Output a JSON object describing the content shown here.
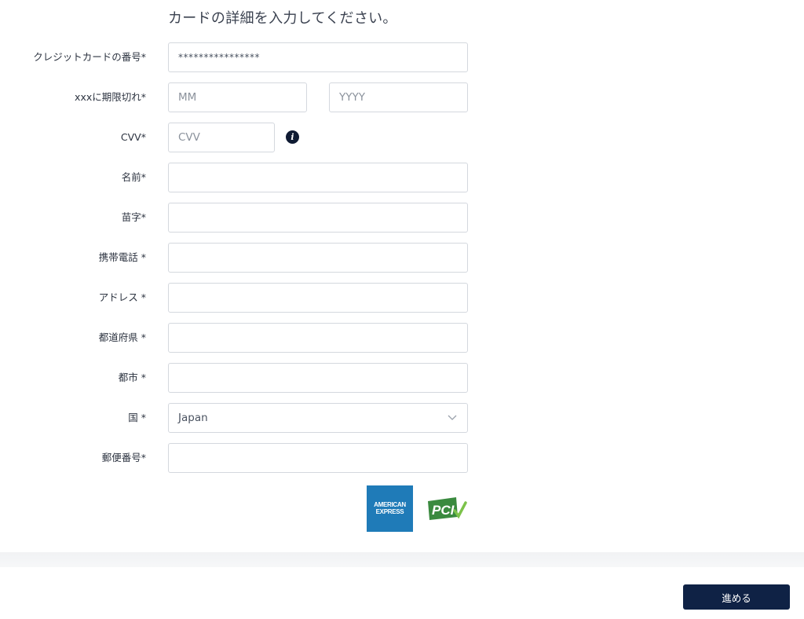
{
  "heading": "カードの詳細を入力してください。",
  "fields": {
    "card_number": {
      "label": "クレジットカードの番号*",
      "value": "****************"
    },
    "expiry": {
      "label": "xxxに期限切れ*",
      "month_placeholder": "MM",
      "year_placeholder": "YYYY"
    },
    "cvv": {
      "label": "CVV*",
      "placeholder": "CVV",
      "info_icon": "info-icon"
    },
    "first_name": {
      "label": "名前*",
      "value": ""
    },
    "last_name": {
      "label": "苗字*",
      "value": ""
    },
    "mobile": {
      "label": "携帯電話 *",
      "value": ""
    },
    "address": {
      "label": "アドレス *",
      "value": ""
    },
    "prefecture": {
      "label": "都道府県 *",
      "value": ""
    },
    "city": {
      "label": "都市 *",
      "value": ""
    },
    "country": {
      "label": "国 *",
      "value": "Japan"
    },
    "postal_code": {
      "label": "郵便番号*",
      "value": ""
    }
  },
  "logos": {
    "amex_line1": "AMERICAN",
    "amex_line2": "EXPRESS",
    "pci": "PCI"
  },
  "footer": {
    "proceed_label": "進める"
  },
  "colors": {
    "primary_button": "#0f2245",
    "info_icon": "#0f1b33",
    "amex_blue": "#1f7bb8",
    "pci_green": "#3a8a3f"
  }
}
